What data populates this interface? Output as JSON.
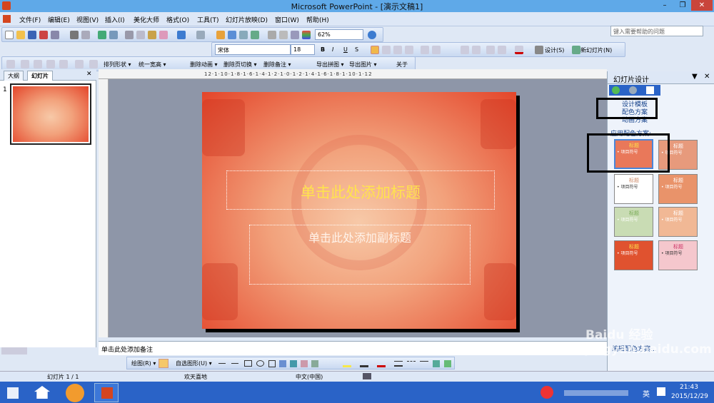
{
  "window": {
    "title": "Microsoft PowerPoint - [演示文稿1]"
  },
  "menu": [
    "文件(F)",
    "编辑(E)",
    "视图(V)",
    "插入(I)",
    "美化大师",
    "格式(O)",
    "工具(T)",
    "幻灯片放映(D)",
    "窗口(W)",
    "帮助(H)"
  ],
  "help_placeholder": "键入需要帮助的问题",
  "toolbar1": {
    "zoom": "62%"
  },
  "toolbar2": {
    "font": "宋体",
    "size": "18",
    "design": "设计(S)",
    "new_slide": "新幻灯片(N)"
  },
  "toolbar3": [
    "排列形状 ▾",
    "统一宽高 ▾",
    "删除动画 ▾",
    "删除页切换 ▾",
    "删除备注 ▾",
    "导出拼图 ▾",
    "导出图片 ▾",
    "关于"
  ],
  "left_tabs": {
    "outline": "大纲",
    "slides": "幻灯片"
  },
  "slide_number": "1",
  "ruler_text": "12·1·10·1·8·1·6·1·4·1·2·1·0·1·2·1·4·1·6·1·8·1·10·1·12",
  "slide": {
    "title_placeholder": "单击此处添加标题",
    "subtitle_placeholder": "单击此处添加副标题"
  },
  "notes_placeholder": "单击此处添加备注",
  "drawbar": {
    "draw": "绘图(R) ▾",
    "autoshape": "自选图形(U) ▾"
  },
  "status": {
    "slide": "幻灯片 1 / 1",
    "theme": "欢天喜地",
    "lang": "中文(中国)"
  },
  "right_pane": {
    "title": "幻灯片设计",
    "links": [
      "设计模板",
      "配色方案",
      "动画方案"
    ],
    "section": "应用配色方案:",
    "footer_link": "编辑配色方案...",
    "thumb_title": "标题",
    "thumb_bullet": "• 项目符号"
  },
  "tray": {
    "time": "21:43",
    "date": "2015/12/29",
    "ime": "英"
  },
  "colors": {
    "accent": "#2a63c7",
    "slide_red": "#e4452a",
    "title_text": "#ffe34d"
  },
  "watermark": "Baidu 经验 jingyan.baidu.com"
}
